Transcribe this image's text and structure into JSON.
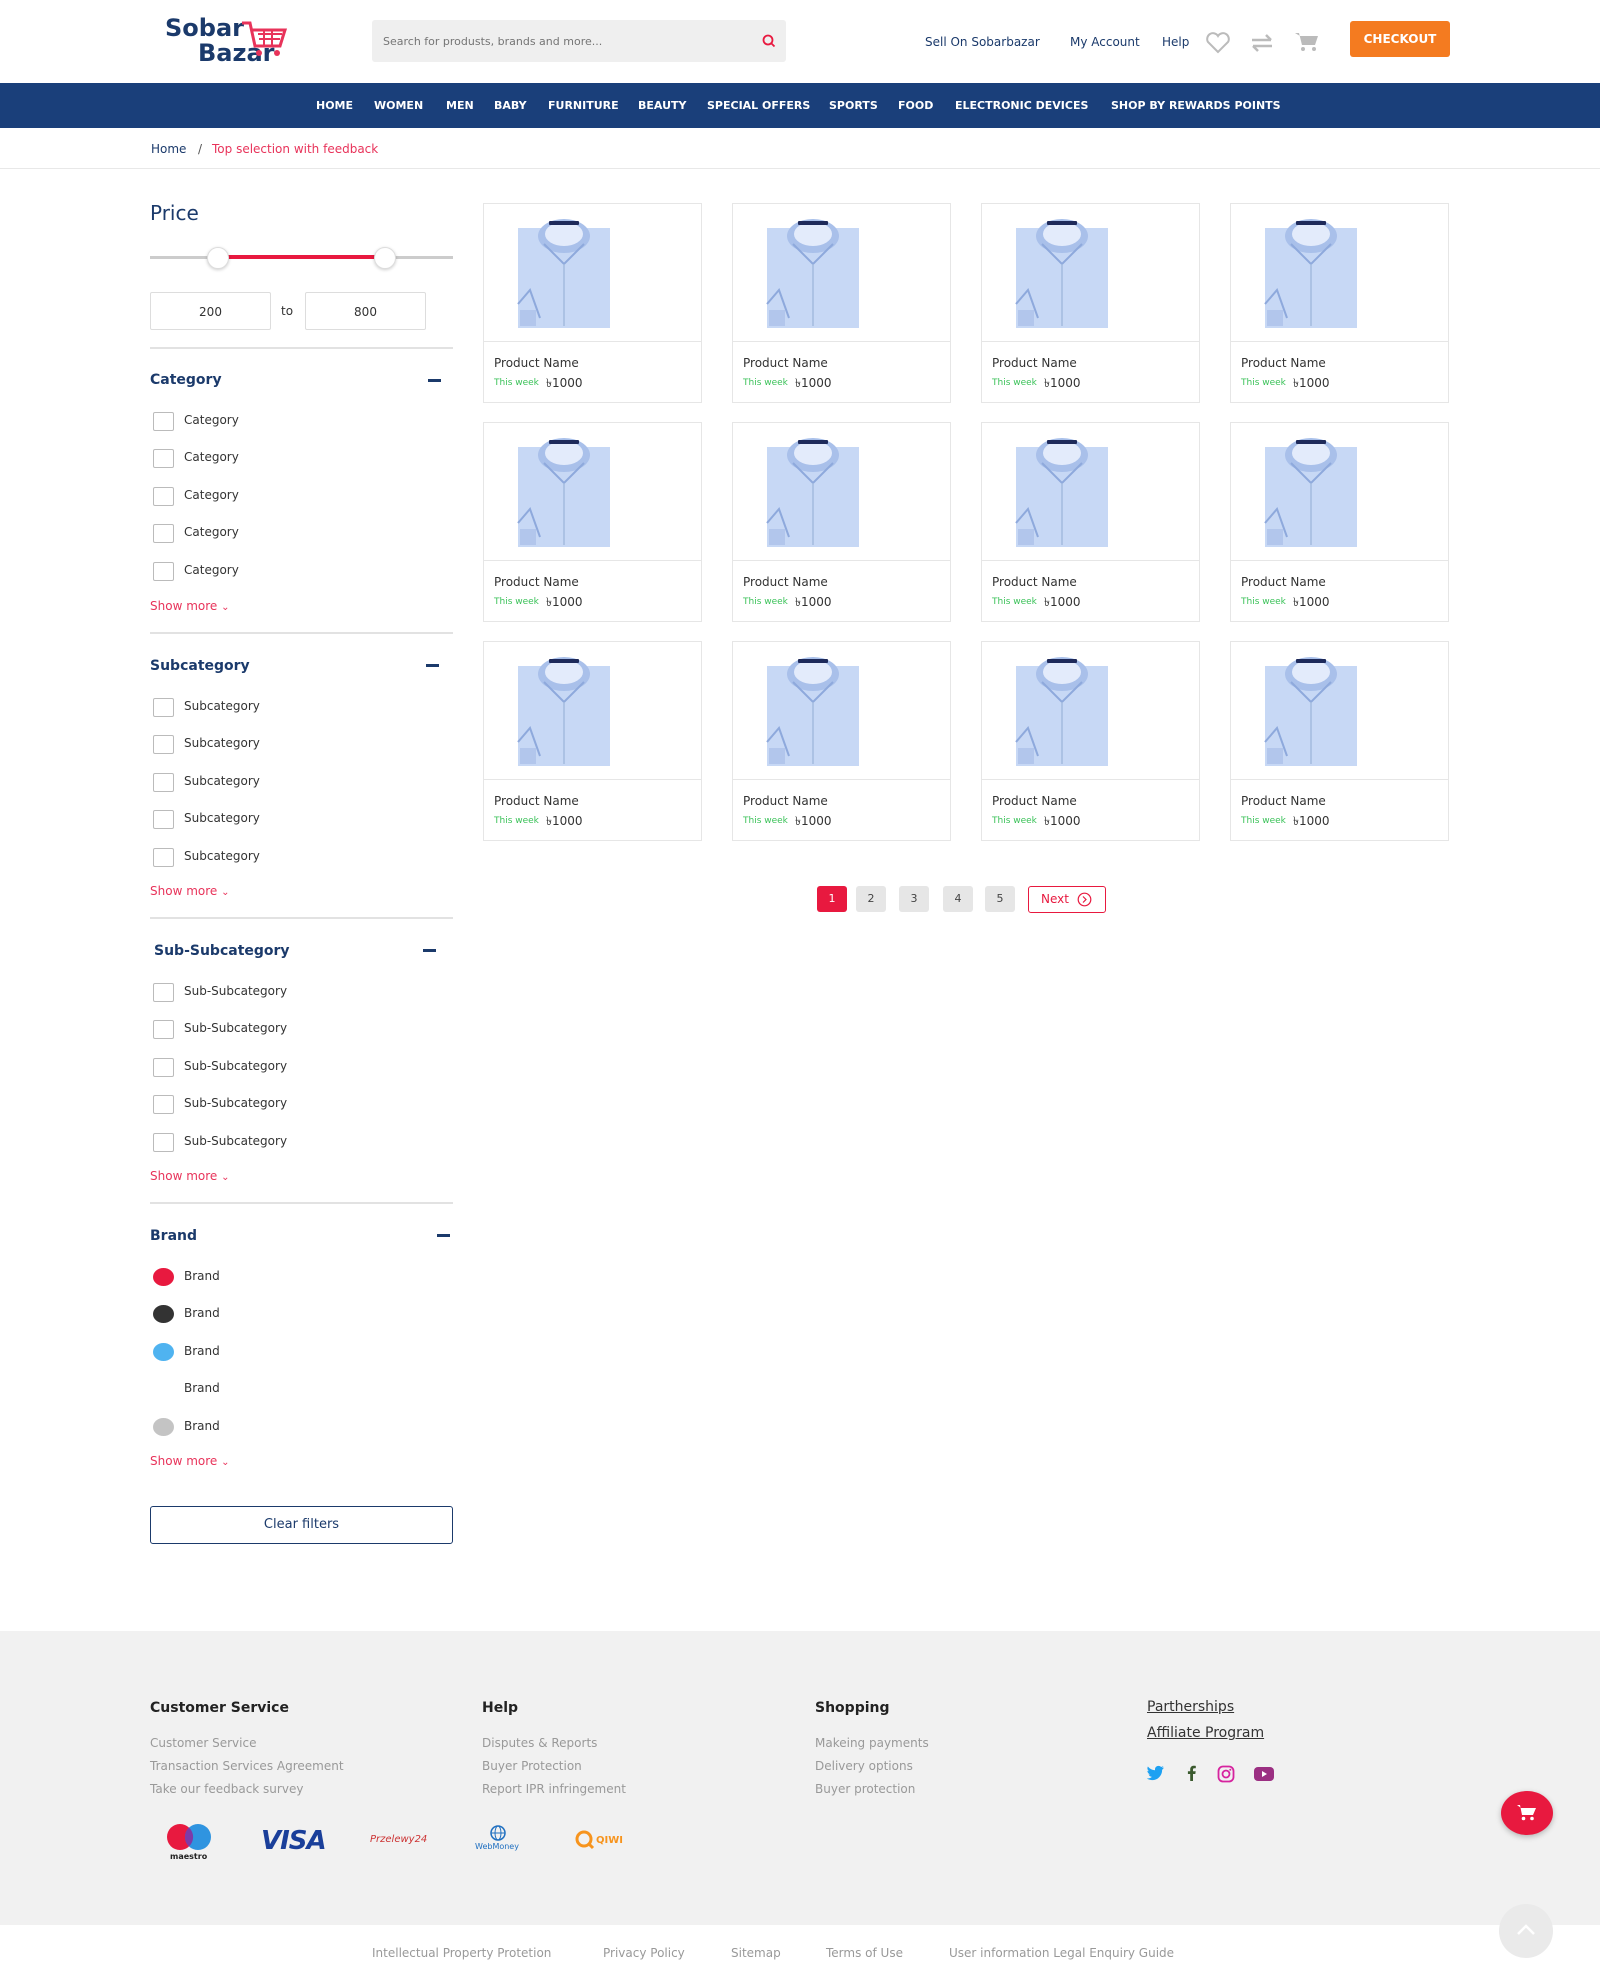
{
  "header": {
    "logo_line1": "Sobar",
    "logo_line2": "Bazar",
    "search_placeholder": "Search for produsts, brands and more...",
    "sell_link": "Sell On Sobarbazar",
    "account_link": "My Account",
    "help_link": "Help",
    "checkout_label": "CHECKOUT",
    "icons": [
      "search-icon",
      "heart-icon",
      "compare-icon",
      "cart-icon"
    ]
  },
  "nav": {
    "items": [
      "HOME",
      "WOMEN",
      "MEN",
      "BABY",
      "FURNITURE",
      "BEAUTY",
      "SPECIAL OFFERS",
      "SPORTS",
      "FOOD",
      "ELECTRONIC DEVICES",
      "SHOP BY REWARDS POINTS"
    ]
  },
  "breadcrumb": {
    "home": "Home",
    "separator": "/",
    "current": "Top selection with feedback"
  },
  "filters": {
    "price": {
      "title": "Price",
      "min": "200",
      "max": "800",
      "to_label": "to"
    },
    "category": {
      "title": "Category",
      "items": [
        "Category",
        "Category",
        "Category",
        "Category",
        "Category"
      ],
      "show_more": "Show more"
    },
    "subcategory": {
      "title": "Subcategory",
      "items": [
        "Subcategory",
        "Subcategory",
        "Subcategory",
        "Subcategory",
        "Subcategory"
      ],
      "show_more": "Show more"
    },
    "subsubcategory": {
      "title": "Sub-Subcategory",
      "items": [
        "Sub-Subcategory",
        "Sub-Subcategory",
        "Sub-Subcategory",
        "Sub-Subcategory",
        "Sub-Subcategory"
      ],
      "show_more": "Show more"
    },
    "brand": {
      "title": "Brand",
      "items": [
        {
          "label": "Brand",
          "color": "#e8193f"
        },
        {
          "label": "Brand",
          "color": "#333333"
        },
        {
          "label": "Brand",
          "color": "#4fb3f0"
        },
        {
          "label": "Brand",
          "color": "#ffffff"
        },
        {
          "label": "Brand",
          "color": "#c4c4c4"
        }
      ],
      "show_more": "Show more"
    },
    "clear_label": "Clear filters"
  },
  "products": [
    {
      "name": "Product Name",
      "week": "This week",
      "price": "৳1000"
    },
    {
      "name": "Product Name",
      "week": "This week",
      "price": "৳1000"
    },
    {
      "name": "Product Name",
      "week": "This week",
      "price": "৳1000"
    },
    {
      "name": "Product Name",
      "week": "This week",
      "price": "৳1000"
    },
    {
      "name": "Product Name",
      "week": "This week",
      "price": "৳1000"
    },
    {
      "name": "Product Name",
      "week": "This week",
      "price": "৳1000"
    },
    {
      "name": "Product Name",
      "week": "This week",
      "price": "৳1000"
    },
    {
      "name": "Product Name",
      "week": "This week",
      "price": "৳1000"
    },
    {
      "name": "Product Name",
      "week": "This week",
      "price": "৳1000"
    },
    {
      "name": "Product Name",
      "week": "This week",
      "price": "৳1000"
    },
    {
      "name": "Product Name",
      "week": "This week",
      "price": "৳1000"
    },
    {
      "name": "Product Name",
      "week": "This week",
      "price": "৳1000"
    }
  ],
  "pagination": {
    "pages": [
      "1",
      "2",
      "3",
      "4",
      "5"
    ],
    "active": "1",
    "next_label": "Next"
  },
  "footer": {
    "columns": [
      {
        "title": "Customer Service",
        "links": [
          "Customer Service",
          "Transaction Services Agreement",
          "Take our feedback survey"
        ]
      },
      {
        "title": "Help",
        "links": [
          "Disputes & Reports",
          "Buyer Protection",
          "Report IPR infringement"
        ]
      },
      {
        "title": "Shopping",
        "links": [
          "Makeing payments",
          "Delivery options",
          "Buyer protection"
        ]
      }
    ],
    "partner_links": [
      "Partherships",
      "Affiliate Program"
    ],
    "social_icons": [
      "twitter-icon",
      "facebook-icon",
      "instagram-icon",
      "youtube-icon"
    ],
    "payment_logos": [
      "maestro",
      "VISA",
      "Przelewy24",
      "WebMoney",
      "QIWI"
    ],
    "bottom_links": [
      "Intellectual Property Protetion",
      "Privacy Policy",
      "Sitemap",
      "Terms of Use",
      "User information Legal Enquiry Guide"
    ]
  },
  "colors": {
    "brand_navy": "#1a3f7a",
    "accent_red": "#e8193f",
    "checkout_orange": "#f47b20",
    "week_green": "#3bc259"
  }
}
